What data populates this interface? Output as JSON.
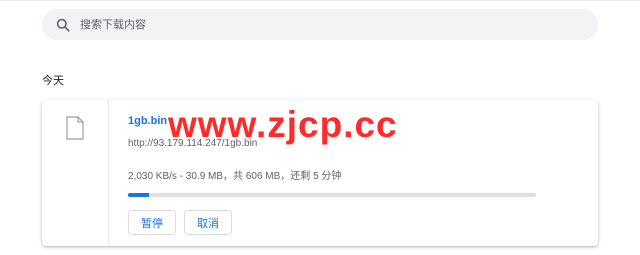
{
  "search": {
    "placeholder": "搜索下载内容",
    "icon": "search-icon"
  },
  "section": {
    "date_label": "今天"
  },
  "download": {
    "file_name": "1gb.bin",
    "url": "http://93.179.114.247/1gb.bin",
    "status": "2,030 KB/s - 30.9 MB，共 606 MB，还剩 5 分钟",
    "progress_fraction": 0.051,
    "buttons": {
      "pause": "暂停",
      "cancel": "取消"
    }
  },
  "watermark": {
    "text": "www.zjcp.cc",
    "color": "#ff2a2a"
  },
  "colors": {
    "accent": "#1a73e8",
    "search_bg": "#f1f3f4",
    "track": "#e0e0e0"
  }
}
